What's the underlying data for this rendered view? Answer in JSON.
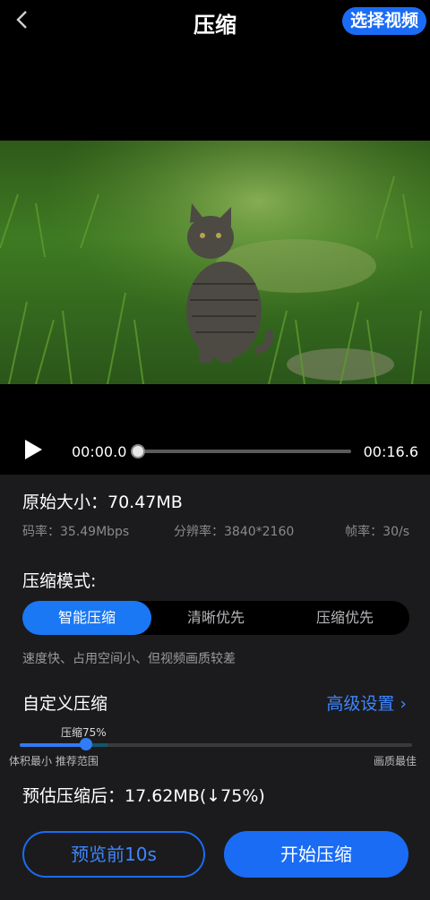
{
  "header": {
    "title": "压缩",
    "select_video": "选择视频"
  },
  "player": {
    "current_time": "00:00.0",
    "total_time": "00:16.6",
    "progress": 0.0
  },
  "info": {
    "original_size": "原始大小：70.47MB",
    "bitrate": "码率：35.49Mbps",
    "resolution": "分辨率：3840*2160",
    "framerate": "帧率：30/s"
  },
  "mode": {
    "title": "压缩模式:",
    "options": [
      "智能压缩",
      "清晰优先",
      "压缩优先"
    ],
    "selected": "智能压缩",
    "description": "速度快、占用空间小、但视频画质较差"
  },
  "custom": {
    "title": "自定义压缩",
    "advanced": "高级设置 ›",
    "slider_label": "压缩75%",
    "slider_value": 0.17,
    "min_label": "体积最小 推荐范围",
    "max_label": "画质最佳"
  },
  "estimate": "预估压缩后：17.62MB(↓75%)",
  "actions": {
    "preview": "预览前10s",
    "start": "开始压缩"
  },
  "colors": {
    "accent": "#1a6cf5",
    "panel": "#1b1b1d"
  }
}
